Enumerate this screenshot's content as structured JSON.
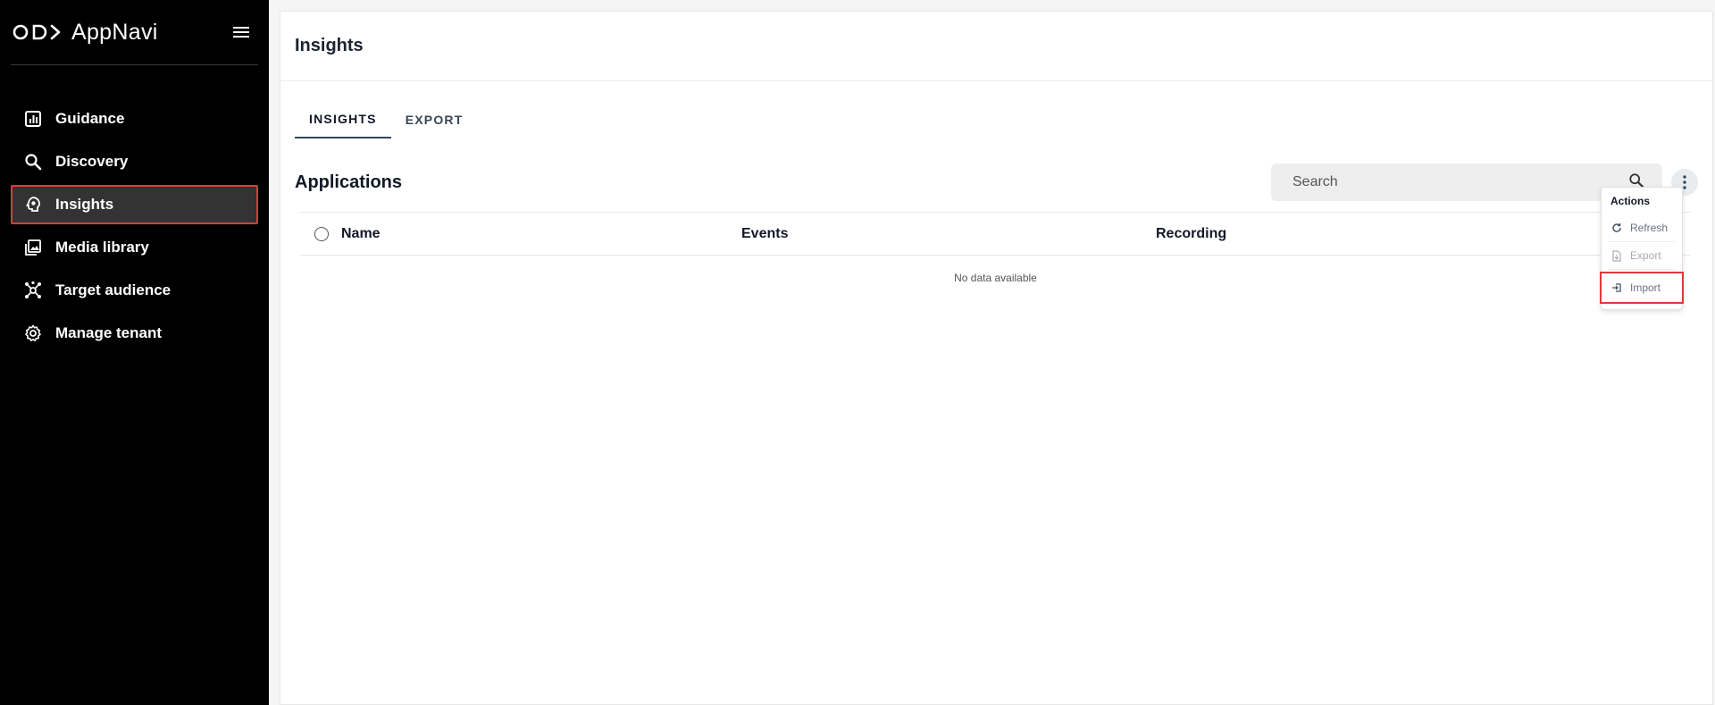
{
  "app": {
    "brand": "AppNavi"
  },
  "sidebar": {
    "items": [
      {
        "label": "Guidance",
        "icon": "bar-chart-icon"
      },
      {
        "label": "Discovery",
        "icon": "search-icon"
      },
      {
        "label": "Insights",
        "icon": "bulb-head-icon",
        "active": true
      },
      {
        "label": "Media library",
        "icon": "image-library-icon"
      },
      {
        "label": "Target audience",
        "icon": "network-icon"
      },
      {
        "label": "Manage tenant",
        "icon": "gear-icon"
      }
    ]
  },
  "header": {
    "title": "Insights"
  },
  "tabs": [
    {
      "label": "INSIGHTS",
      "active": true
    },
    {
      "label": "EXPORT",
      "active": false
    }
  ],
  "main": {
    "section_title": "Applications",
    "search": {
      "placeholder": "Search",
      "value": ""
    },
    "table": {
      "columns": [
        "Name",
        "Events",
        "Recording"
      ],
      "empty_text": "No data available"
    }
  },
  "actions_menu": {
    "header": "Actions",
    "items": [
      {
        "label": "Refresh",
        "icon": "refresh-icon",
        "disabled": false
      },
      {
        "label": "Export",
        "icon": "file-export-icon",
        "disabled": true
      },
      {
        "label": "Import",
        "icon": "import-icon",
        "disabled": false,
        "highlighted": true
      }
    ]
  },
  "colors": {
    "sidebar_bg": "#000000",
    "active_outline": "#e03a3a",
    "active_item_bg": "#333333"
  }
}
